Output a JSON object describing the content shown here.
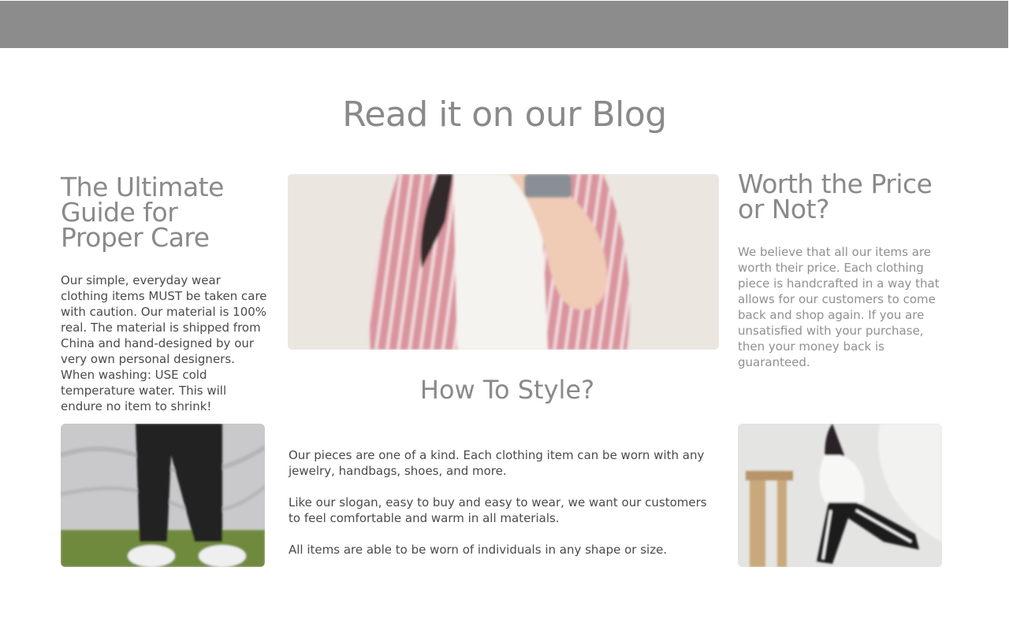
{
  "section": {
    "title": "Read it on our Blog"
  },
  "care_post": {
    "title": "The Ultimate Guide for Proper Care",
    "body": "Our simple, everyday wear clothing items MUST be taken care with caution. Our material is 100% real. The material is shipped from China and hand-designed by our very own personal designers. When washing: USE cold temperature water. This will endure no item to shrink!"
  },
  "price_post": {
    "title": "Worth the Price or Not?",
    "body": "We believe that all our items are worth their price. Each clothing piece is handcrafted in a way that allows for our customers to come back and shop again. If you are unsatisfied with your purchase, then your money back is guaranteed."
  },
  "style_post": {
    "title": "How To Style?",
    "paragraphs": [
      "Our pieces are one of a kind. Each clothing item can be worn with any jewelry, handbags, shoes, and more.",
      "Like our slogan, easy to buy and easy to wear, we want our customers to feel comfortable and warm in all materials.",
      "All items are able to be worn of individuals in any shape or size."
    ]
  },
  "colors": {
    "header_bar": "#8c8c8c",
    "heading_text": "#8a8a8a",
    "body_text": "#4a4a4a",
    "muted_text": "#909090"
  }
}
